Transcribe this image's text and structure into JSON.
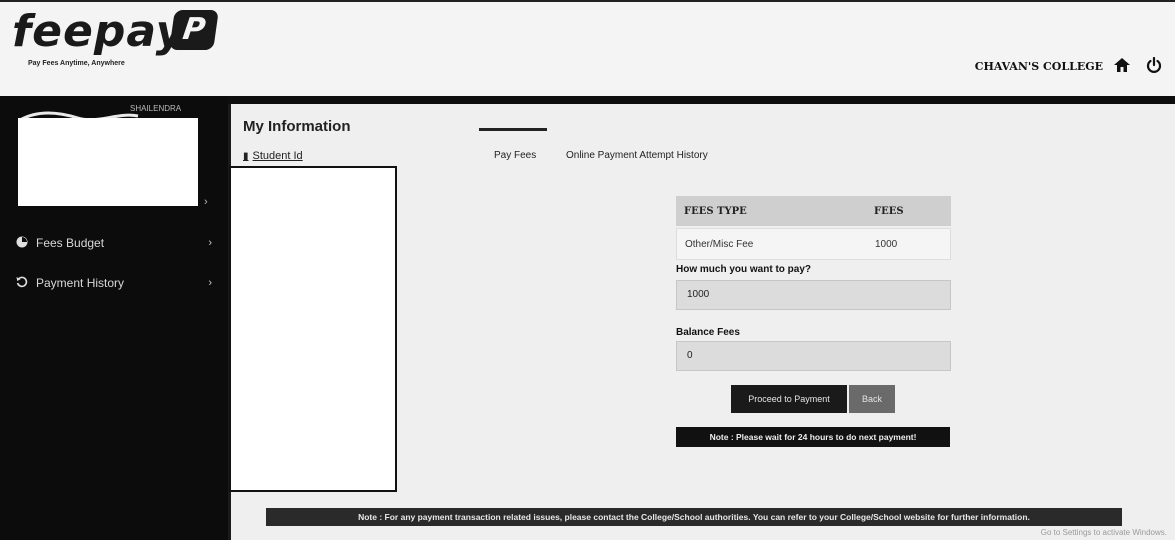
{
  "header": {
    "logo_text": "feepayr",
    "logo_badge": "P",
    "tagline": "Pay Fees Anytime, Anywhere",
    "college_name": "CHAVAN'S COLLEGE",
    "home_icon": "home-icon",
    "power_icon": "power-icon"
  },
  "sidebar": {
    "name_fragment": "SHAILENDRA",
    "items": [
      {
        "label": "Fees Budget",
        "icon": "budget-icon"
      },
      {
        "label": "Payment History",
        "icon": "history-icon"
      }
    ]
  },
  "main": {
    "section_title": "My Information",
    "student_id_label": "Student Id",
    "tabs": [
      {
        "label": "Pay Fees",
        "active": true
      },
      {
        "label": "Online Payment Attempt History",
        "active": false
      }
    ],
    "fees_table": {
      "headers": [
        "FEES TYPE",
        "FEES"
      ],
      "rows": [
        [
          "Other/Misc Fee",
          "1000"
        ]
      ]
    },
    "pay_amount_label": "How much you want to pay?",
    "pay_amount_value": "1000",
    "balance_label": "Balance Fees",
    "balance_value": "0",
    "proceed_label": "Proceed to Payment",
    "back_label": "Back",
    "note_wait": "Note : Please wait for 24 hours to do next payment!",
    "note_bottom": "Note : For any payment transaction related issues, please contact the College/School authorities. You can refer to your College/School website for further information.",
    "watermark": "Go to Settings to activate Windows."
  },
  "colors": {
    "sidebar_bg": "#0c0c0c",
    "panel_bg": "#efefef",
    "table_header_bg": "#cfcfcf",
    "button_dark": "#1a1a1a",
    "button_grey": "#6a6a6a"
  }
}
